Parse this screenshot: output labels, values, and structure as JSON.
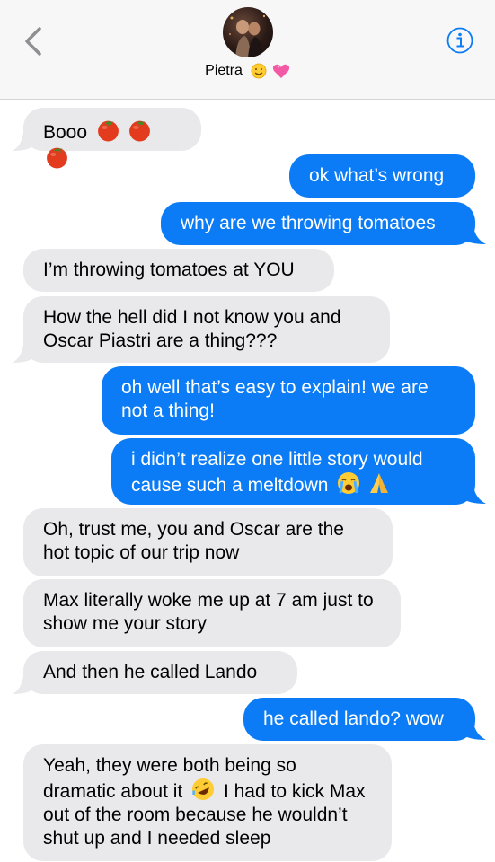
{
  "header": {
    "contact_name": "Pietra",
    "name_emojis": [
      "smile-emoji",
      "heart-emoji"
    ]
  },
  "messages": [
    {
      "id": "m1",
      "direction": "incoming",
      "text": "Booo",
      "emojis": [
        "tomato",
        "tomato",
        "tomato"
      ]
    },
    {
      "id": "m2",
      "direction": "outgoing",
      "text": "ok what’s wrong"
    },
    {
      "id": "m3",
      "direction": "outgoing",
      "text": "why are we throwing tomatoes"
    },
    {
      "id": "m4",
      "direction": "incoming",
      "text": "I’m throwing tomatoes at YOU"
    },
    {
      "id": "m5",
      "direction": "incoming",
      "text": "How the hell did I not know you and Oscar Piastri are a thing???"
    },
    {
      "id": "m6",
      "direction": "outgoing",
      "text": "oh well that’s easy to explain! we are not a thing!"
    },
    {
      "id": "m7",
      "direction": "outgoing",
      "text": "i didn’t realize one little story would cause such a meltdown",
      "emojis": [
        "crying-emoji",
        "praying-hands-emoji"
      ]
    },
    {
      "id": "m8",
      "direction": "incoming",
      "text": "Oh, trust me, you and Oscar are the hot topic of our trip now"
    },
    {
      "id": "m9",
      "direction": "incoming",
      "text": "Max literally woke me up at 7 am just to show me your story"
    },
    {
      "id": "m10",
      "direction": "incoming",
      "text": "And then he called Lando"
    },
    {
      "id": "m11",
      "direction": "outgoing",
      "text": "he called lando? wow"
    },
    {
      "id": "m12",
      "direction": "incoming",
      "text_part1": "Yeah, they were both being so dramatic about it",
      "emojis": [
        "rolling-laughing-emoji"
      ],
      "text_part2": "I had to kick Max out of the room because he wouldn’t shut up and I needed sleep"
    }
  ],
  "colors": {
    "outgoing": "#0b7cf5",
    "incoming": "#e9e9eb",
    "header_bg": "#f7f7f7",
    "accent": "#0b7cf5"
  }
}
